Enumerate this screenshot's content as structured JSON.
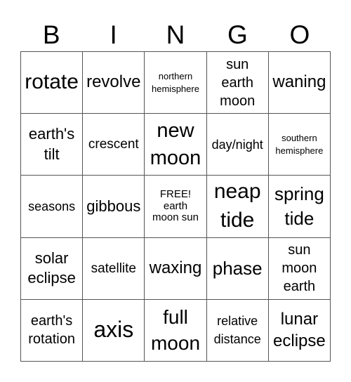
{
  "header": {
    "letters": [
      "B",
      "I",
      "N",
      "G",
      "O"
    ]
  },
  "cells": [
    "rotate",
    "revolve",
    "northern\nhemisphere",
    "sun\nearth\nmoon",
    "waning",
    "earth's\ntilt",
    "crescent",
    "new\nmoon",
    "day/night",
    "southern\nhemisphere",
    "seasons",
    "gibbous",
    "FREE!\nearth\nmoon sun",
    "neap\ntide",
    "spring\ntide",
    "solar\neclipse",
    "satellite",
    "waxing",
    "phase",
    "sun\nmoon\nearth",
    "earth's\nrotation",
    "axis",
    "full\nmoon",
    "relative\ndistance",
    "lunar\neclipse"
  ]
}
